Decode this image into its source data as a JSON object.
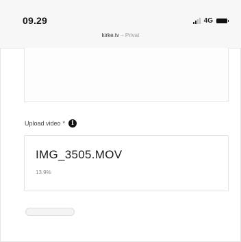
{
  "status_bar": {
    "time": "09.29",
    "network": "4G",
    "signal_icon": "signal-bars-icon",
    "battery_icon": "battery-icon"
  },
  "address_bar": {
    "domain": "kirke.tv",
    "separator": "–",
    "mode": "Privat"
  },
  "upload": {
    "label": "Upload video",
    "required_mark": "*",
    "info_icon": "info-icon",
    "info_glyph": "i",
    "file_name": "IMG_3505.MOV",
    "progress_text": "13.9%",
    "progress_fraction": 0.139
  },
  "colors": {
    "background": "#ffffff",
    "status_bar_bg": "#f7f7f7",
    "text_primary": "#1a1a1a",
    "text_muted": "#888888"
  }
}
